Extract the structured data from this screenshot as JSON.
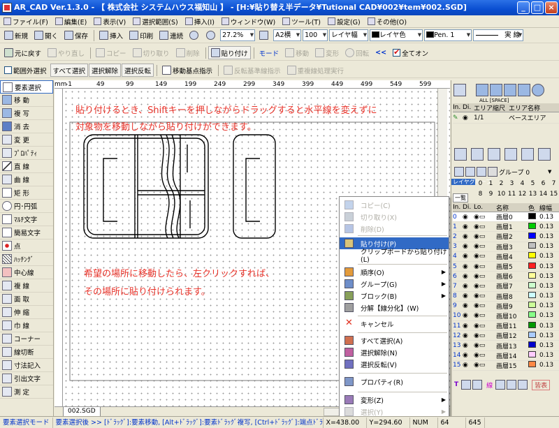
{
  "window": {
    "title": "AR_CAD Ver.1.3.0 - 【 株式会社 システムハウス福知山 】 - [H:¥貼り替え半データ¥Tutional CAD¥002¥tem¥002.SGD]"
  },
  "menu": [
    "ファイル(F)",
    "編集(E)",
    "表示(V)",
    "選択範囲(S)",
    "挿入(I)",
    "ウィンドウ(W)",
    "ツール(T)",
    "設定(G)",
    "その他(O)"
  ],
  "toolbar1": {
    "new": "新規",
    "open": "開く",
    "save": "保存",
    "insert": "挿入",
    "print": "印刷",
    "continuous": "連続",
    "zoom": "27.2%",
    "paper": "A2横",
    "scale": "100",
    "layer_width": "レイヤ幅",
    "layer_color": "レイヤ色",
    "pen": "Pen. 1",
    "linetype": "実 線"
  },
  "toolbar2": {
    "undo": "元に戻す",
    "redo": "やり直し",
    "copy": "コピー",
    "cut": "切り取り",
    "delete": "削除",
    "paste": "貼り付け",
    "mode": "モード",
    "move": "移動",
    "transform": "変形",
    "rotate": "回転",
    "all_on": "全てオン"
  },
  "toolbar3": {
    "outside_select": "範囲外選択",
    "select_all": "すべて選択",
    "deselect": "選択解除",
    "invert": "選択反転",
    "move_base": "移動基点指示",
    "reverse_base": "反転基準線指示",
    "overlap": "重複線処理実行"
  },
  "tools": [
    "要素選択",
    "移 動",
    "複 写",
    "消 去",
    "変 更",
    "ﾌﾟﾛﾊﾟﾃｨ",
    "直 線",
    "曲 線",
    "矩 形",
    "円･円弧",
    "ﾏﾙﾁ文字",
    "簡易文字",
    "点",
    "ﾊｯﾁﾝｸﾞ",
    "中心線",
    "複 線",
    "面 取",
    "伸 縮",
    "巾 線",
    "コーナー",
    "線切断",
    "寸法記入",
    "引出文字",
    "測 定"
  ],
  "ruler": {
    "unit": "mm",
    "marks": [
      "-1",
      "49",
      "99",
      "149",
      "199",
      "249",
      "299",
      "349",
      "399",
      "449",
      "499",
      "549",
      "599"
    ]
  },
  "canvas": {
    "note1_line1": "貼り付けるとき、Shiftキーを押しながらドラッグすると水平線を変えずに",
    "note1_line2": "対象物を移動しながら貼り付けができます。",
    "note2_line1": "希望の場所に移動したら、左クリックすれば、",
    "note2_line2": "その場所に貼り付けられます。",
    "tab": "002.SGD"
  },
  "context_menu": [
    {
      "label": "コピー(C)",
      "icon": "copy-icon",
      "disabled": true
    },
    {
      "label": "切り取り(X)",
      "icon": "cut-icon",
      "disabled": true
    },
    {
      "label": "削除(D)",
      "icon": "delete-icon",
      "disabled": true
    },
    {
      "label": "貼り付け(P)",
      "icon": "paste-icon",
      "highlighted": true
    },
    {
      "label": "クリップボードから貼り付け(L)",
      "icon": "none"
    },
    {
      "label": "順序(O)",
      "icon": "order-icon",
      "submenu": true
    },
    {
      "label": "グループ(G)",
      "icon": "group-icon",
      "submenu": true
    },
    {
      "label": "ブロック(B)",
      "icon": "block-icon",
      "submenu": true
    },
    {
      "label": "分解【線分化】(W)",
      "icon": "explode-icon"
    },
    {
      "label": "キャンセル",
      "icon": "cancel-icon"
    },
    {
      "label": "すべて選択(A)",
      "icon": "select-all-icon"
    },
    {
      "label": "選択解除(N)",
      "icon": "deselect-icon"
    },
    {
      "label": "選択反転(V)",
      "icon": "invert-icon"
    },
    {
      "label": "プロパティ(R)",
      "icon": "properties-icon"
    },
    {
      "label": "変形(Z)",
      "icon": "transform-icon",
      "submenu": true
    },
    {
      "label": "選択(Y)",
      "icon": "select-icon",
      "submenu": true,
      "disabled": true
    }
  ],
  "right_panel": {
    "snap_label": "ALL [SPACE]",
    "area_headers": [
      "In.",
      "Di.",
      "エリア縮尺",
      "エリア名称"
    ],
    "area_row": {
      "scale": "1/1",
      "name": "ベースエリア"
    },
    "group_label": "グループ 0",
    "layer_group_label": "レイヤグループ",
    "list_label": "一覧",
    "group_numbers": [
      "0",
      "1",
      "2",
      "3",
      "4",
      "5",
      "6",
      "7",
      "8",
      "9",
      "10",
      "11",
      "12",
      "13",
      "14",
      "15"
    ],
    "layer_headers": [
      "In.",
      "Di.",
      "Lo.",
      "名称",
      "色",
      "線幅"
    ],
    "layers": [
      {
        "num": "0",
        "name": "画層0",
        "color": "#000000",
        "width": "0.13"
      },
      {
        "num": "1",
        "name": "画層1",
        "color": "#00cc00",
        "width": "0.13"
      },
      {
        "num": "2",
        "name": "画層2",
        "color": "#0000ff",
        "width": "0.13"
      },
      {
        "num": "3",
        "name": "画層3",
        "color": "#c0c0c0",
        "width": "0.13"
      },
      {
        "num": "4",
        "name": "画層4",
        "color": "#ffff00",
        "width": "0.13"
      },
      {
        "num": "5",
        "name": "画層5",
        "color": "#ff2020",
        "width": "0.13"
      },
      {
        "num": "6",
        "name": "画層6",
        "color": "#ffff99",
        "width": "0.13"
      },
      {
        "num": "7",
        "name": "画層7",
        "color": "#ccffcc",
        "width": "0.13"
      },
      {
        "num": "8",
        "name": "画層8",
        "color": "#ccffff",
        "width": "0.13"
      },
      {
        "num": "9",
        "name": "画層9",
        "color": "#ccff99",
        "width": "0.13"
      },
      {
        "num": "10",
        "name": "画層10",
        "color": "#88ff88",
        "width": "0.13"
      },
      {
        "num": "11",
        "name": "画層11",
        "color": "#009900",
        "width": "0.13"
      },
      {
        "num": "12",
        "name": "画層12",
        "color": "#aaccff",
        "width": "0.13"
      },
      {
        "num": "13",
        "name": "画層13",
        "color": "#0000cc",
        "width": "0.13"
      },
      {
        "num": "14",
        "name": "画層14",
        "color": "#ffccff",
        "width": "0.13"
      },
      {
        "num": "15",
        "name": "画層15",
        "color": "#ff8844",
        "width": "0.13"
      }
    ],
    "bottom_label": "線",
    "bottom_button": "皆表"
  },
  "status": {
    "mode": "要素選択モード",
    "hint": "要素選択後 >> [ﾄﾞﾗｯｸﾞ]:要素移動, [Alt+ﾄﾞﾗｯｸﾞ]:要素ﾄﾞﾗｯｸﾞ複写, [Ctrl+ﾄﾞﾗｯｸﾞ]:端点ﾄﾞﾗｯｸﾞ移動",
    "x": "X=438.00",
    "y": "Y=294.60",
    "num": "NUM",
    "v1": "64",
    "v2": "645"
  }
}
